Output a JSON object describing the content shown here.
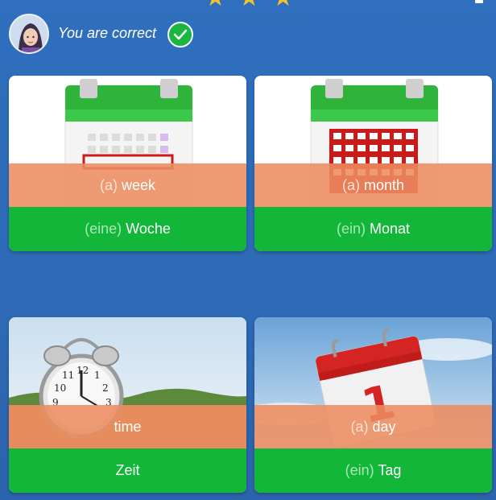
{
  "header": {
    "feedback": "You are correct",
    "star_count": 3
  },
  "cards": [
    {
      "en_article": "(a)",
      "en_word": "week",
      "de_article": "(eine)",
      "de_word": "Woche",
      "image": "calendar-week-icon"
    },
    {
      "en_article": "(a)",
      "en_word": "month",
      "de_article": "(ein)",
      "de_word": "Monat",
      "image": "calendar-month-icon"
    },
    {
      "en_article": "",
      "en_word": "time",
      "de_article": "",
      "de_word": "Zeit",
      "image": "alarm-clock-in-grass-image"
    },
    {
      "en_article": "(a)",
      "en_word": "day",
      "de_article": "(ein)",
      "de_word": "Tag",
      "image": "calendar-page-day-image"
    }
  ],
  "colors": {
    "background": "#2f6fbd",
    "correct_green": "#12b73a",
    "label_band": "#ec8c60",
    "star": "#f2c230"
  }
}
